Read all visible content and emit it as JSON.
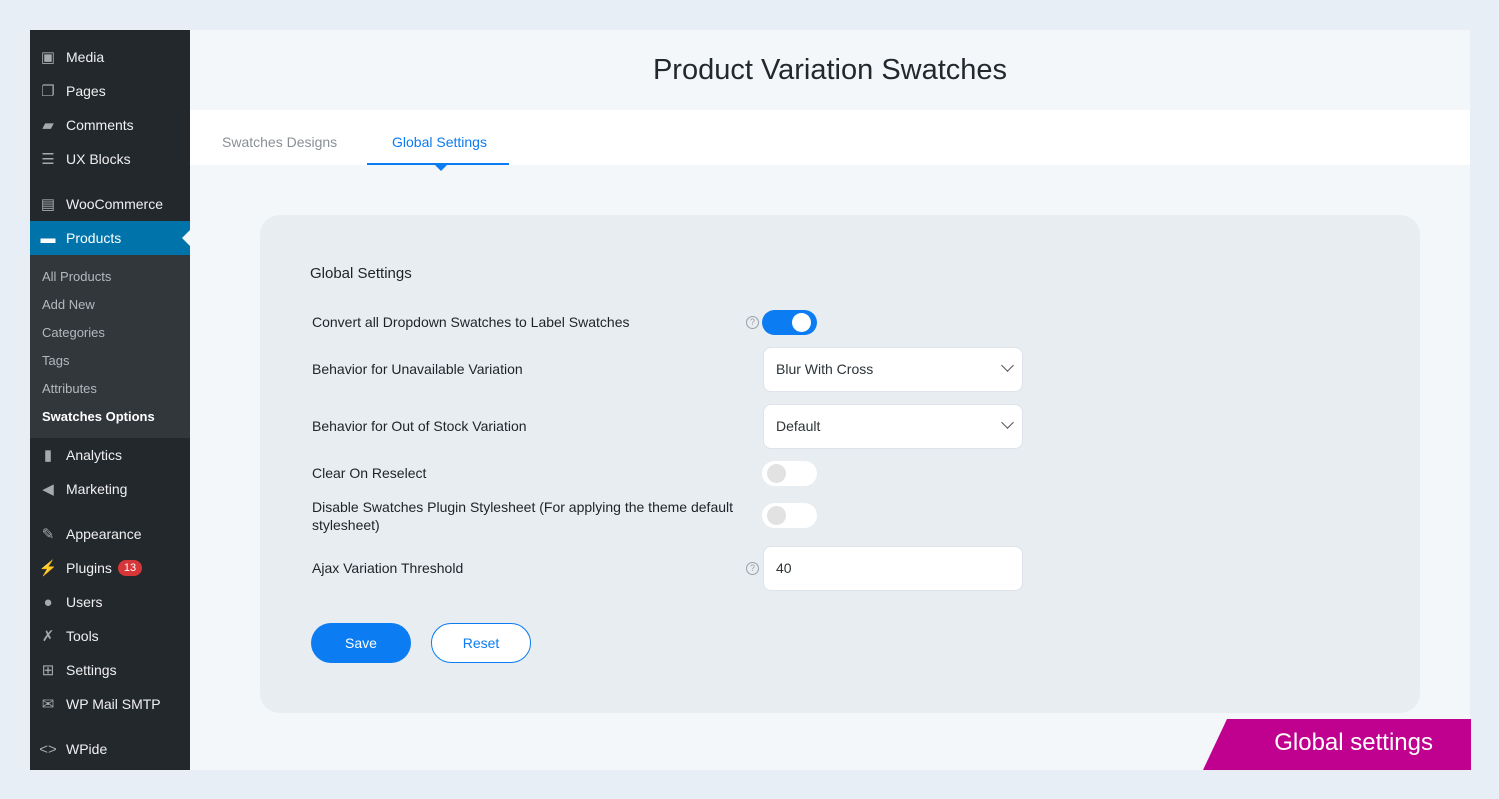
{
  "sidebar": {
    "items": [
      {
        "label": "Media",
        "icon": "media-icon"
      },
      {
        "label": "Pages",
        "icon": "pages-icon"
      },
      {
        "label": "Comments",
        "icon": "comments-icon"
      },
      {
        "label": "UX Blocks",
        "icon": "ux-blocks-icon"
      },
      {
        "label": "WooCommerce",
        "icon": "woocommerce-icon"
      },
      {
        "label": "Products",
        "icon": "products-icon"
      },
      {
        "label": "Analytics",
        "icon": "analytics-icon"
      },
      {
        "label": "Marketing",
        "icon": "marketing-icon"
      },
      {
        "label": "Appearance",
        "icon": "appearance-icon"
      },
      {
        "label": "Plugins",
        "icon": "plugins-icon",
        "badge": "13"
      },
      {
        "label": "Users",
        "icon": "users-icon"
      },
      {
        "label": "Tools",
        "icon": "tools-icon"
      },
      {
        "label": "Settings",
        "icon": "settings-icon"
      },
      {
        "label": "WP Mail SMTP",
        "icon": "mail-icon"
      },
      {
        "label": "WPide",
        "icon": "code-icon"
      }
    ],
    "submenu": [
      "All Products",
      "Add New",
      "Categories",
      "Tags",
      "Attributes",
      "Swatches Options"
    ]
  },
  "header": {
    "title": "Product Variation Swatches"
  },
  "tabs": [
    "Swatches Designs",
    "Global Settings"
  ],
  "settings": {
    "heading": "Global Settings",
    "convert_label": "Convert all Dropdown Swatches to Label Swatches",
    "convert_on": true,
    "unavailable_label": "Behavior for Unavailable Variation",
    "unavailable_value": "Blur With Cross",
    "outofstock_label": "Behavior for Out of Stock Variation",
    "outofstock_value": "Default",
    "clear_label": "Clear On Reselect",
    "clear_on": false,
    "disable_label": "Disable Swatches Plugin Stylesheet (For applying the theme default stylesheet)",
    "disable_on": false,
    "ajax_label": "Ajax Variation Threshold",
    "ajax_value": "40",
    "help": "?",
    "save": "Save",
    "reset": "Reset"
  },
  "banner": "Global settings",
  "colors": {
    "accent": "#0b7cf2",
    "sidebar": "#23282d",
    "active": "#0073aa",
    "banner": "#c0008e"
  }
}
